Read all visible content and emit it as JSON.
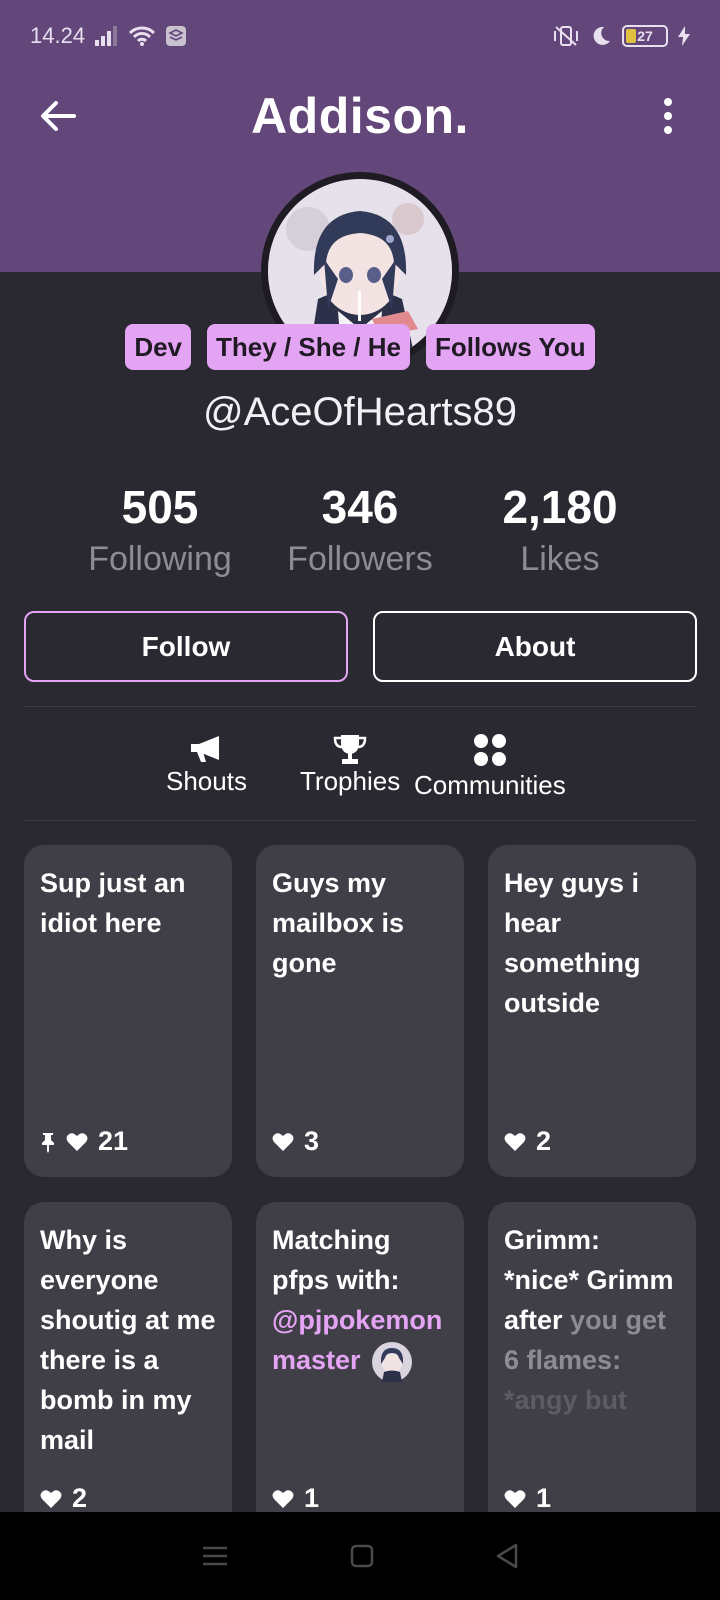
{
  "status_bar": {
    "time": "14.24",
    "battery": "27"
  },
  "header": {
    "title": "Addison."
  },
  "profile": {
    "badges": [
      "Dev",
      "They / She / He",
      "Follows You"
    ],
    "handle": "@AceOfHearts89",
    "stats": [
      {
        "value": "505",
        "label": "Following"
      },
      {
        "value": "346",
        "label": "Followers"
      },
      {
        "value": "2,180",
        "label": "Likes"
      }
    ]
  },
  "actions": {
    "follow_label": "Follow",
    "about_label": "About"
  },
  "tabs": [
    {
      "label": "Shouts",
      "icon": "megaphone-icon"
    },
    {
      "label": "Trophies",
      "icon": "trophy-icon"
    },
    {
      "label": "Communities",
      "icon": "communities-icon"
    }
  ],
  "posts": [
    {
      "text": "Sup just an idiot here",
      "likes": "21",
      "pinned": true
    },
    {
      "text": "Guys my mailbox is gone",
      "likes": "3"
    },
    {
      "text": "Hey guys i hear something outside",
      "likes": "2"
    },
    {
      "text": "Why is everyone shoutig at me there is a bomb in my mail",
      "likes": "2"
    },
    {
      "text": "Matching pfps with:",
      "mention": "@pjpokemonmaster",
      "likes": "1"
    },
    {
      "text_line1": "Grimm: *nice* Grimm after",
      "text_line2": "you get 6 flames:",
      "text_line3": "*angy but",
      "likes": "1"
    }
  ],
  "colors": {
    "header": "#63467a",
    "accent": "#e3a4f3",
    "card": "#403e46",
    "background": "#2a2830"
  }
}
